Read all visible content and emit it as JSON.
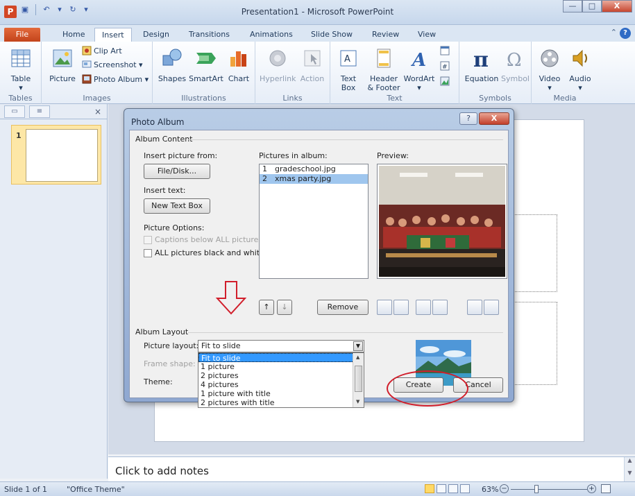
{
  "window": {
    "title": "Presentation1 - Microsoft PowerPoint",
    "app_icon_letter": "P",
    "minimize": "—",
    "maximize": "□",
    "close": "X"
  },
  "tabs": [
    "File",
    "Home",
    "Insert",
    "Design",
    "Transitions",
    "Animations",
    "Slide Show",
    "Review",
    "View"
  ],
  "active_tab": "Insert",
  "ribbon": {
    "tables": {
      "table": "Table",
      "group": "Tables"
    },
    "images": {
      "picture": "Picture",
      "clip_art": "Clip Art",
      "screenshot": "Screenshot ▾",
      "photo_album": "Photo Album ▾",
      "group": "Images"
    },
    "illustrations": {
      "shapes": "Shapes",
      "smartart": "SmartArt",
      "chart": "Chart",
      "group": "Illustrations"
    },
    "links": {
      "hyperlink": "Hyperlink",
      "action": "Action",
      "group": "Links"
    },
    "text": {
      "text_box_1": "Text",
      "text_box_2": "Box",
      "header_1": "Header",
      "header_2": "& Footer",
      "wordart": "WordArt",
      "group": "Text"
    },
    "symbols": {
      "equation": "Equation",
      "symbol": "Symbol",
      "group": "Symbols"
    },
    "media": {
      "video": "Video",
      "audio": "Audio",
      "group": "Media"
    }
  },
  "slides_panel": {
    "slide_number": "1",
    "close": "×"
  },
  "notes": {
    "placeholder": "Click to add notes"
  },
  "status": {
    "slide": "Slide 1 of 1",
    "theme": "\"Office Theme\"",
    "zoom": "63%"
  },
  "dialog": {
    "title": "Photo Album",
    "help": "?",
    "close": "X",
    "album_content": "Album Content",
    "insert_picture_from": "Insert picture from:",
    "file_disk_button": "File/Disk...",
    "insert_text": "Insert text:",
    "new_text_box_button": "New Text Box",
    "picture_options": "Picture Options:",
    "captions_below": "Captions below ALL pictures",
    "all_bw": "ALL pictures black and white",
    "pictures_in_album": "Pictures in album:",
    "pictures": [
      {
        "num": "1",
        "name": "gradeschool.jpg"
      },
      {
        "num": "2",
        "name": "xmas party.jpg"
      }
    ],
    "preview": "Preview:",
    "up_arrow": "↑",
    "down_arrow": "↓",
    "remove_button": "Remove",
    "album_layout": "Album Layout",
    "picture_layout": "Picture layout:",
    "frame_shape": "Frame shape:",
    "theme": "Theme:",
    "layout_value": "Fit to slide",
    "layout_options": [
      "Fit to slide",
      "1 picture",
      "2 pictures",
      "4 pictures",
      "1 picture with title",
      "2 pictures with title"
    ],
    "create_button": "Create",
    "cancel_button": "Cancel"
  },
  "colors": {
    "accent_red": "#d11e2b",
    "selection_blue": "#3399ff"
  }
}
